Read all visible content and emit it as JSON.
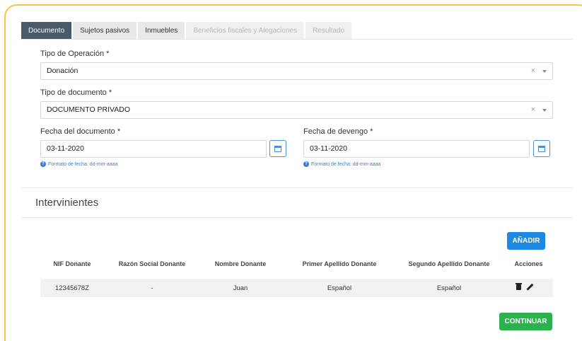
{
  "tabs": [
    {
      "label": "Documento",
      "state": "active"
    },
    {
      "label": "Sujetos pasivos",
      "state": "normal"
    },
    {
      "label": "Inmuebles",
      "state": "normal"
    },
    {
      "label": "Beneficios fiscales y Alegaciones",
      "state": "disabled"
    },
    {
      "label": "Resultado",
      "state": "disabled"
    }
  ],
  "form": {
    "tipo_operacion_label": "Tipo de Operación *",
    "tipo_operacion_value": "Donación",
    "tipo_documento_label": "Tipo de documento *",
    "tipo_documento_value": "DOCUMENTO PRIVADO",
    "fecha_documento_label": "Fecha del documento *",
    "fecha_documento_value": "03-11-2020",
    "fecha_devengo_label": "Fecha de devengo *",
    "fecha_devengo_value": "03-11-2020",
    "date_hint": "Formato de fecha: dd-mm-aaaa",
    "clear_symbol": "×"
  },
  "intervinientes": {
    "title": "Intervinientes",
    "add_button": "AÑADIR",
    "columns": [
      "NIF Donante",
      "Razón Social Donante",
      "Nombre Donante",
      "Primer Apellido Donante",
      "Segundo Apellido Donante",
      "Acciones"
    ],
    "rows": [
      {
        "nif": "12345678Z",
        "razon_social": "-",
        "nombre": "Juan",
        "primer_apellido": "Español",
        "segundo_apellido": "Español"
      }
    ]
  },
  "continue_button": "CONTINUAR",
  "colors": {
    "frame": "#f5c24a",
    "active_tab": "#4a5a6b",
    "primary": "#1e88e5",
    "success": "#2bb24c"
  }
}
